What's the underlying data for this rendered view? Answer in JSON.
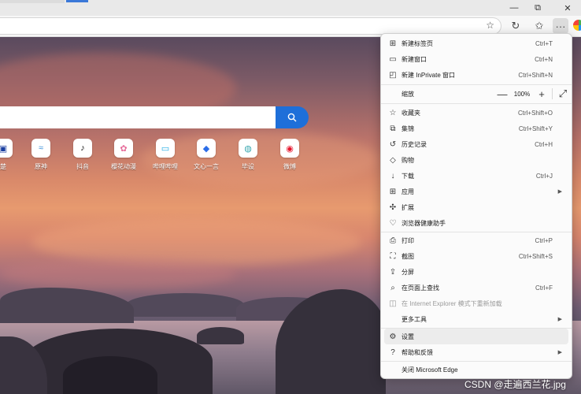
{
  "window": {
    "minimize_glyph": "—",
    "restore_glyph": "⧉",
    "close_glyph": "✕"
  },
  "toolbar": {
    "favorite_glyph": "☆",
    "refresh_glyph": "↻",
    "favorites_glyph": "✩",
    "more_glyph": "···"
  },
  "search": {
    "button_icon": "search-icon"
  },
  "quick_links": [
    {
      "label": "楚",
      "glyph": "▣",
      "color": "#1b3fa0"
    },
    {
      "label": "原神",
      "glyph": "≈",
      "color": "#3a8fd8"
    },
    {
      "label": "抖音",
      "glyph": "♪",
      "color": "#111111"
    },
    {
      "label": "樱花动漫",
      "glyph": "✿",
      "color": "#e66c9a"
    },
    {
      "label": "哔哩哔哩",
      "glyph": "▭",
      "color": "#23ade5"
    },
    {
      "label": "文心一言",
      "glyph": "◆",
      "color": "#2b6de8"
    },
    {
      "label": "毕设",
      "glyph": "◍",
      "color": "#3aa8b0"
    },
    {
      "label": "微博",
      "glyph": "◉",
      "color": "#e6162d"
    }
  ],
  "menu": {
    "items": [
      {
        "id": "new-tab",
        "icon": "new-tab-icon",
        "glyph": "⊞",
        "label": "新建标签页",
        "shortcut": "Ctrl+T"
      },
      {
        "id": "new-window",
        "icon": "new-window-icon",
        "glyph": "▭",
        "label": "新建窗口",
        "shortcut": "Ctrl+N"
      },
      {
        "id": "new-inprivate",
        "icon": "inprivate-icon",
        "glyph": "◰",
        "label": "新建 InPrivate 窗口",
        "shortcut": "Ctrl+Shift+N"
      }
    ],
    "zoom": {
      "label": "缩放",
      "minus": "—",
      "value": "100%",
      "plus": "+",
      "fullscreen": "⤢"
    },
    "items2": [
      {
        "id": "favorites",
        "icon": "favorites-icon",
        "glyph": "☆",
        "label": "收藏夹",
        "shortcut": "Ctrl+Shift+O"
      },
      {
        "id": "collections",
        "icon": "collections-icon",
        "glyph": "⧉",
        "label": "集锦",
        "shortcut": "Ctrl+Shift+Y"
      },
      {
        "id": "history",
        "icon": "history-icon",
        "glyph": "↺",
        "label": "历史记录",
        "shortcut": "Ctrl+H"
      },
      {
        "id": "shopping",
        "icon": "shopping-tag-icon",
        "glyph": "◇",
        "label": "购物",
        "shortcut": ""
      },
      {
        "id": "downloads",
        "icon": "download-icon",
        "glyph": "↓",
        "label": "下载",
        "shortcut": "Ctrl+J"
      },
      {
        "id": "apps",
        "icon": "apps-icon",
        "glyph": "⊞",
        "label": "应用",
        "shortcut": "",
        "submenu": true
      },
      {
        "id": "extensions",
        "icon": "extensions-icon",
        "glyph": "✣",
        "label": "扩展",
        "shortcut": ""
      },
      {
        "id": "browser-essentials",
        "icon": "heart-pulse-icon",
        "glyph": "♡",
        "label": "浏览器健康助手",
        "shortcut": ""
      }
    ],
    "items3": [
      {
        "id": "print",
        "icon": "print-icon",
        "glyph": "⎙",
        "label": "打印",
        "shortcut": "Ctrl+P"
      },
      {
        "id": "screenshot",
        "icon": "screenshot-icon",
        "glyph": "⛶",
        "label": "截图",
        "shortcut": "Ctrl+Shift+S"
      },
      {
        "id": "share",
        "icon": "share-icon",
        "glyph": "⇪",
        "label": "分屏",
        "shortcut": ""
      },
      {
        "id": "find",
        "icon": "find-icon",
        "glyph": "⌕",
        "label": "在页面上查找",
        "shortcut": "Ctrl+F"
      },
      {
        "id": "ie-mode",
        "icon": "ie-mode-icon",
        "glyph": "◫",
        "label": "在 Internet Explorer 模式下重新加载",
        "shortcut": "",
        "disabled": true
      },
      {
        "id": "more-tools",
        "icon": "",
        "glyph": "",
        "label": "更多工具",
        "shortcut": "",
        "submenu": true
      }
    ],
    "items4": [
      {
        "id": "settings",
        "icon": "gear-icon",
        "glyph": "⚙",
        "label": "设置",
        "shortcut": "",
        "highlighted": true
      },
      {
        "id": "help",
        "icon": "help-icon",
        "glyph": "?",
        "label": "帮助和反馈",
        "shortcut": "",
        "submenu": true
      }
    ],
    "close": {
      "label": "关闭 Microsoft Edge"
    },
    "submenu_glyph": "▶"
  },
  "watermark": "CSDN @走遍西兰花.jpg"
}
